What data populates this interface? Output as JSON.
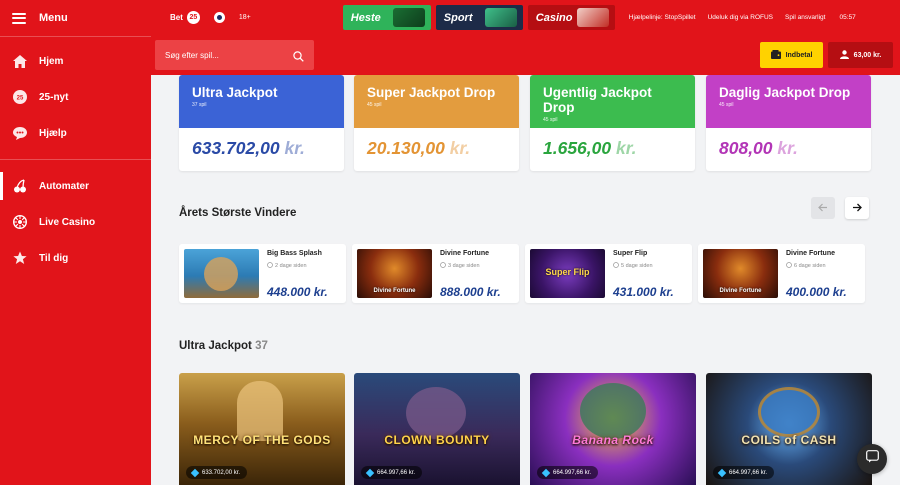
{
  "sidebar": {
    "title": "Menu",
    "items": [
      {
        "label": "Hjem",
        "icon": "home-icon"
      },
      {
        "label": "25-nyt",
        "icon": "news-icon"
      },
      {
        "label": "Hjælp",
        "icon": "help-chat-icon"
      },
      {
        "label": "Automater",
        "icon": "cherry-icon",
        "active": true
      },
      {
        "label": "Live Casino",
        "icon": "roulette-icon"
      },
      {
        "label": "Til dig",
        "icon": "star-icon"
      }
    ]
  },
  "topbar": {
    "brand": "Bet",
    "brand_badge": "25",
    "age": "18+",
    "products": [
      "Heste",
      "Sport",
      "Casino"
    ],
    "links": [
      "Hjælpelinje: StopSpillet",
      "Udeluk dig via ROFUS",
      "Spil ansvarligt"
    ],
    "clock": "05:57"
  },
  "search": {
    "placeholder": "Søg efter spil..."
  },
  "account": {
    "deposit": "Indbetal",
    "balance": "63,00 kr."
  },
  "jackpots": [
    {
      "title": "Ultra Jackpot",
      "sub": "37 spil",
      "amount": "633.702,00",
      "currency": "kr.",
      "color": "#3b63d6",
      "amount_color": "#2a4aa6"
    },
    {
      "title": "Super Jackpot Drop",
      "sub": "45 spil",
      "amount": "20.130,00",
      "currency": "kr.",
      "color": "#e39c3e",
      "amount_color": "#e39434"
    },
    {
      "title": "Ugentlig Jackpot Drop",
      "sub": "45 spil",
      "amount": "1.656,00",
      "currency": "kr.",
      "color": "#3cbc4f",
      "amount_color": "#2aa53e"
    },
    {
      "title": "Daglig Jackpot Drop",
      "sub": "45 spil",
      "amount": "808,00",
      "currency": "kr.",
      "color": "#c240c6",
      "amount_color": "#b235b6"
    }
  ],
  "winners": {
    "title": "Årets Største Vindere",
    "items": [
      {
        "game": "Big Bass Splash",
        "time": "2 dage siden",
        "amount": "448.000 kr."
      },
      {
        "game": "Divine Fortune",
        "time": "3 dage siden",
        "amount": "888.000 kr."
      },
      {
        "game": "Super Flip",
        "time": "5 dage siden",
        "amount": "431.000 kr."
      },
      {
        "game": "Divine Fortune",
        "time": "6 dage siden",
        "amount": "400.000 kr."
      }
    ]
  },
  "ultra_section": {
    "title": "Ultra Jackpot",
    "count": "37",
    "games": [
      {
        "name": "MERCY OF THE GODS",
        "jackpot": "633.702,00 kr."
      },
      {
        "name": "CLOWN BOUNTY",
        "jackpot": "664.997,66 kr."
      },
      {
        "name": "Banana Rock",
        "jackpot": "664.997,66 kr."
      },
      {
        "name": "COILS of CASH",
        "jackpot": "664.997,66 kr."
      }
    ]
  }
}
